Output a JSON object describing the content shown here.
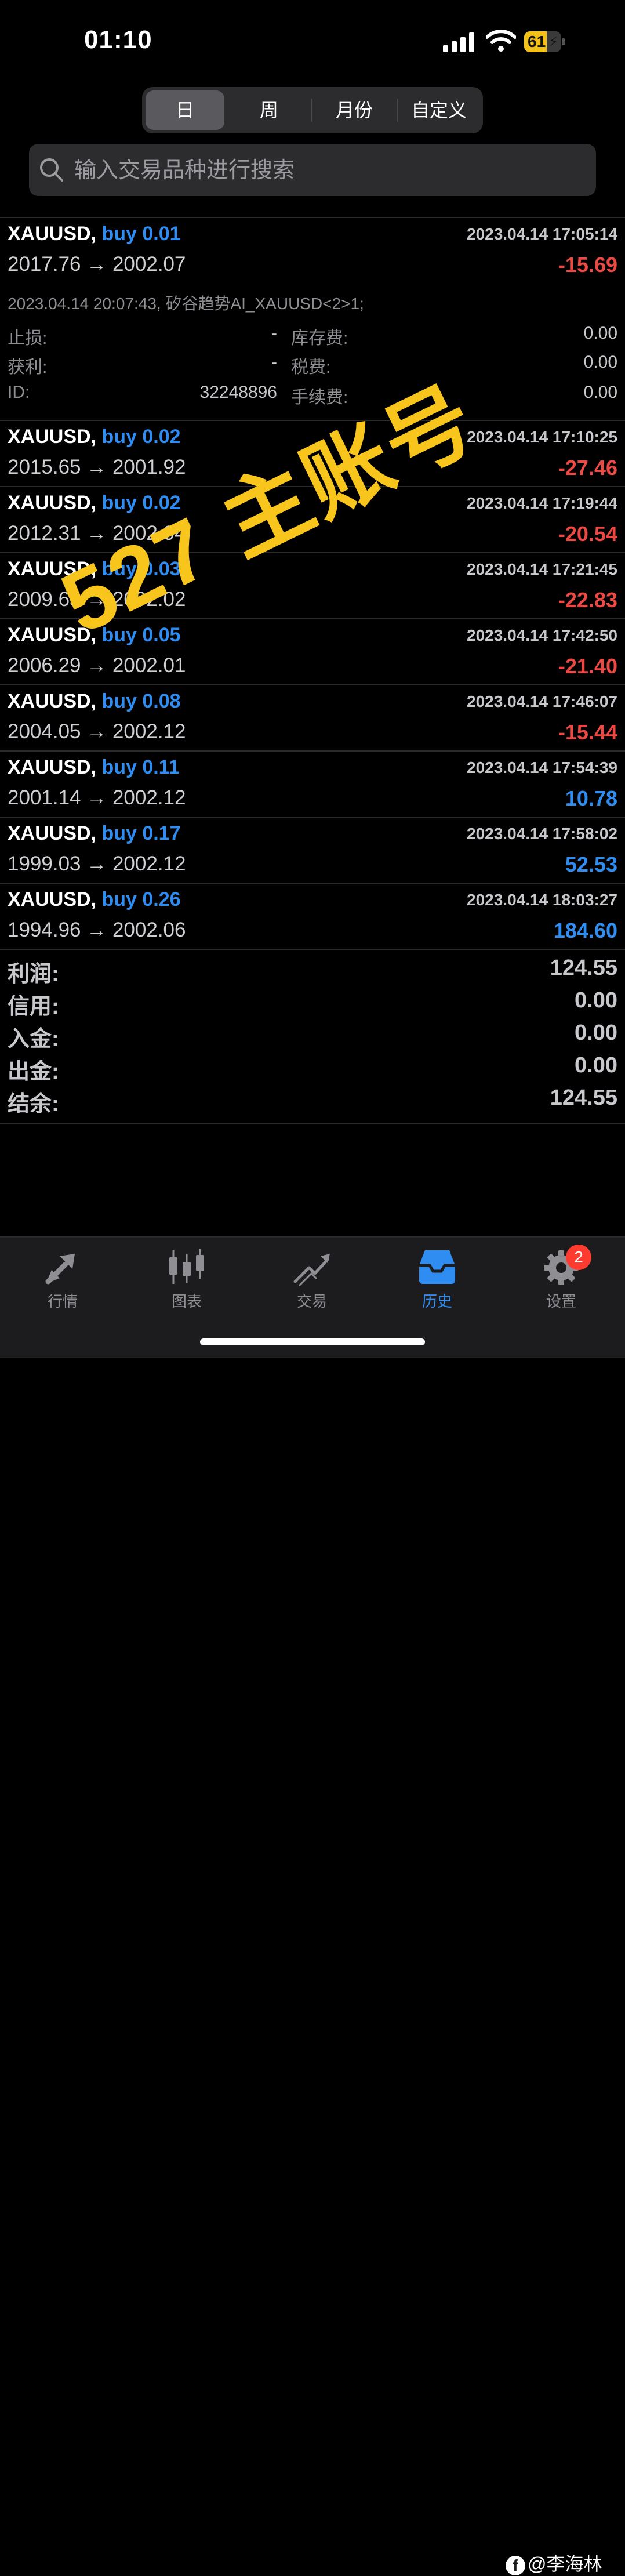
{
  "status_bar": {
    "time": "01:10",
    "battery": "61",
    "battery_level": 0.61
  },
  "segments": [
    {
      "label": "日",
      "active": true
    },
    {
      "label": "周",
      "active": false
    },
    {
      "label": "月份",
      "active": false
    },
    {
      "label": "自定义",
      "active": false
    }
  ],
  "search": {
    "placeholder": "输入交易品种进行搜索",
    "value": ""
  },
  "colors": {
    "buy": "#2f8cf1",
    "loss": "#ea4a43",
    "profit": "#2f8cf1",
    "overlay": "#f7c51c",
    "accent": "#2f8cf1"
  },
  "deals": [
    {
      "symbol": "XAUUSD,",
      "side": "buy 0.01",
      "time": "2023.04.14 17:05:14",
      "prices": "2017.76 → 2002.07",
      "profit": "-15.69",
      "comment": "2023.04.14 20:07:43, 矽谷趋势AI_XAUUSD<2>1;",
      "details": {
        "sl_label": "止损:",
        "sl_value": "-",
        "tp_label": "获利:",
        "tp_value": "-",
        "id_label": "ID:",
        "id_value": "32248896",
        "swap_label": "库存费:",
        "swap_value": "0.00",
        "tax_label": "税费:",
        "tax_value": "0.00",
        "fee_label": "手续费:",
        "fee_value": "0.00"
      }
    },
    {
      "symbol": "XAUUSD,",
      "side": "buy 0.02",
      "time": "2023.04.14 17:10:25",
      "prices": "2015.65 → 2001.92",
      "profit": "-27.46"
    },
    {
      "symbol": "XAUUSD,",
      "side": "buy 0.02",
      "time": "2023.04.14 17:19:44",
      "prices": "2012.31 → 2002.04",
      "profit": "-20.54"
    },
    {
      "symbol": "XAUUSD,",
      "side": "buy 0.03",
      "time": "2023.04.14 17:21:45",
      "prices": "2009.63 → 2002.02",
      "profit": "-22.83"
    },
    {
      "symbol": "XAUUSD,",
      "side": "buy 0.05",
      "time": "2023.04.14 17:42:50",
      "prices": "2006.29 → 2002.01",
      "profit": "-21.40"
    },
    {
      "symbol": "XAUUSD,",
      "side": "buy 0.08",
      "time": "2023.04.14 17:46:07",
      "prices": "2004.05 → 2002.12",
      "profit": "-15.44"
    },
    {
      "symbol": "XAUUSD,",
      "side": "buy 0.11",
      "time": "2023.04.14 17:54:39",
      "prices": "2001.14 → 2002.12",
      "profit": "10.78"
    },
    {
      "symbol": "XAUUSD,",
      "side": "buy 0.17",
      "time": "2023.04.14 17:58:02",
      "prices": "1999.03 → 2002.12",
      "profit": "52.53"
    },
    {
      "symbol": "XAUUSD,",
      "side": "buy 0.26",
      "time": "2023.04.14 18:03:27",
      "prices": "1994.96 → 2002.06",
      "profit": "184.60"
    }
  ],
  "summary": [
    {
      "label": "利润:",
      "value": "124.55"
    },
    {
      "label": "信用:",
      "value": "0.00"
    },
    {
      "label": "入金:",
      "value": "0.00"
    },
    {
      "label": "出金:",
      "value": "0.00"
    },
    {
      "label": "结余:",
      "value": "124.55"
    }
  ],
  "overlay_text": "527 主账号",
  "tabs": [
    {
      "label": "行情",
      "icon": "quotes-arrows-icon",
      "active": false
    },
    {
      "label": "图表",
      "icon": "candlestick-chart-icon",
      "active": false
    },
    {
      "label": "交易",
      "icon": "trade-chart-icon",
      "active": false
    },
    {
      "label": "历史",
      "icon": "history-inbox-icon",
      "active": true
    },
    {
      "label": "设置",
      "icon": "gear-icon",
      "active": false,
      "badge": "2"
    }
  ],
  "watermark": {
    "logo": "f",
    "text": "@李海林"
  }
}
